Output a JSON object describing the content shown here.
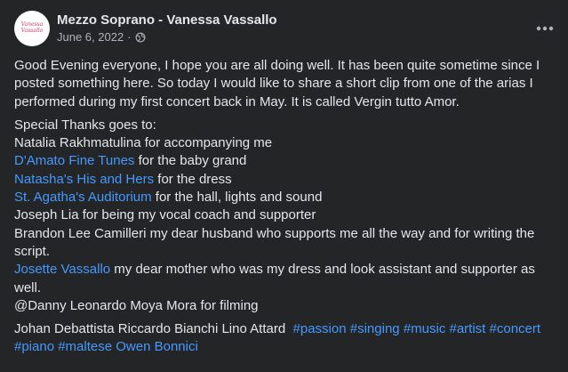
{
  "post": {
    "page_name": "Mezzo Soprano - Vanessa Vassallo",
    "date": "June 6, 2022",
    "separator": "·",
    "avatar_text": "Vanessa Vassallo",
    "intro": "Good Evening everyone, I hope you are all doing well. It has been quite sometime since I posted something here. So today I would like to share a short clip from one of the arias I performed during my first concert back in May. It is called Vergin tutto Amor.",
    "thanks_heading": "Special Thanks goes to:",
    "thanks": [
      {
        "link": "",
        "text": "Natalia Rakhmatulina for accompanying me"
      },
      {
        "link": "D'Amato Fine Tunes",
        "text": " for the baby grand"
      },
      {
        "link": "Natasha's His and Hers",
        "text": " for the dress"
      },
      {
        "link": "St. Agatha's Auditorium",
        "text": " for the hall, lights and sound"
      },
      {
        "link": "",
        "text": "Joseph Lia for being my vocal coach and supporter"
      },
      {
        "link": "",
        "text": "Brandon Lee Camilleri my dear husband who supports me all the way and for writing the script."
      },
      {
        "link": "Josette Vassallo",
        "text": " my dear mother who was my dress and look assistant and supporter as well."
      },
      {
        "link": "",
        "text": "@Danny Leonardo Moya Mora for filming"
      }
    ],
    "credits_text": "Johan Debattista Riccardo Bianchi Lino Attard",
    "hashtags": [
      "#passion",
      "#singing",
      "#music",
      "#artist",
      "#concert",
      "#piano",
      "#maltese"
    ],
    "trailing_text": "Owen Bonnici"
  },
  "colors": {
    "background": "#242526",
    "text": "#e4e6eb",
    "secondary": "#b0b3b8",
    "link": "#4599ff"
  },
  "icons": {
    "audience": "globe-icon",
    "menu": "more-horizontal-icon"
  }
}
